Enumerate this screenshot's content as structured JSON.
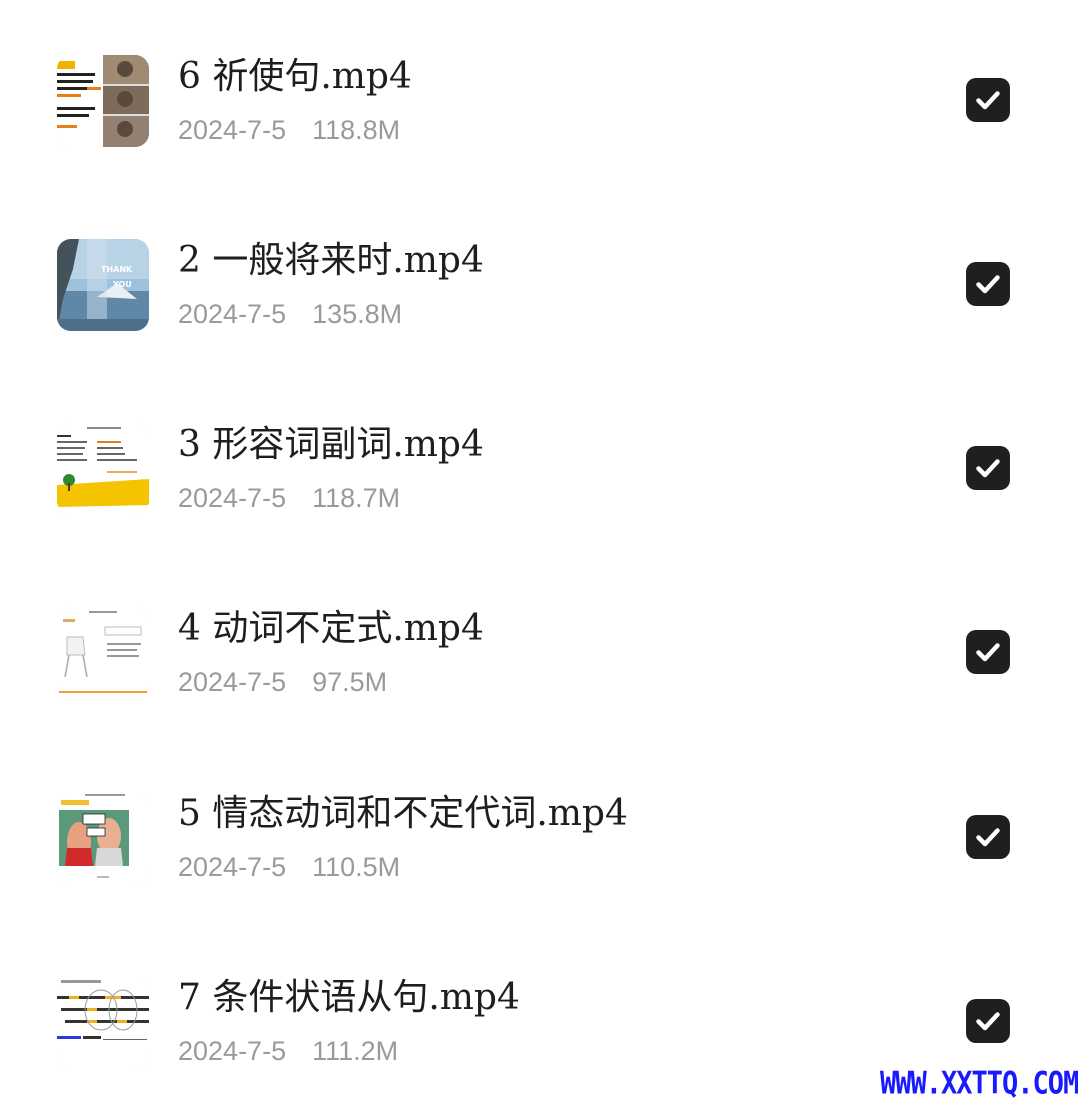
{
  "files": [
    {
      "name": "6 祈使句.mp4",
      "date": "2024-7-5",
      "size": "118.8M",
      "checked": true,
      "thumbnail": "lecture-slide-with-video-frames"
    },
    {
      "name": "2 一般将来时.mp4",
      "date": "2024-7-5",
      "size": "135.8M",
      "checked": true,
      "thumbnail": "thank-you-landscape-slide"
    },
    {
      "name": "3 形容词副词.mp4",
      "date": "2024-7-5",
      "size": "118.7M",
      "checked": true,
      "thumbnail": "grammar-slide-yellow-ground"
    },
    {
      "name": "4 动词不定式.mp4",
      "date": "2024-7-5",
      "size": "97.5M",
      "checked": true,
      "thumbnail": "slide-with-chair"
    },
    {
      "name": "5 情态动词和不定代词.mp4",
      "date": "2024-7-5",
      "size": "110.5M",
      "checked": true,
      "thumbnail": "comic-couple-slide"
    },
    {
      "name": "7 条件状语从句.mp4",
      "date": "2024-7-5",
      "size": "111.2M",
      "checked": true,
      "thumbnail": "conditional-sentences-slide"
    }
  ],
  "watermark": "WWW.XXTTQ.COM",
  "colors": {
    "title": "#1e1e1e",
    "meta": "#9a9a9a",
    "checkbox": "#1f1f1f",
    "watermark": "#1a1aff"
  }
}
